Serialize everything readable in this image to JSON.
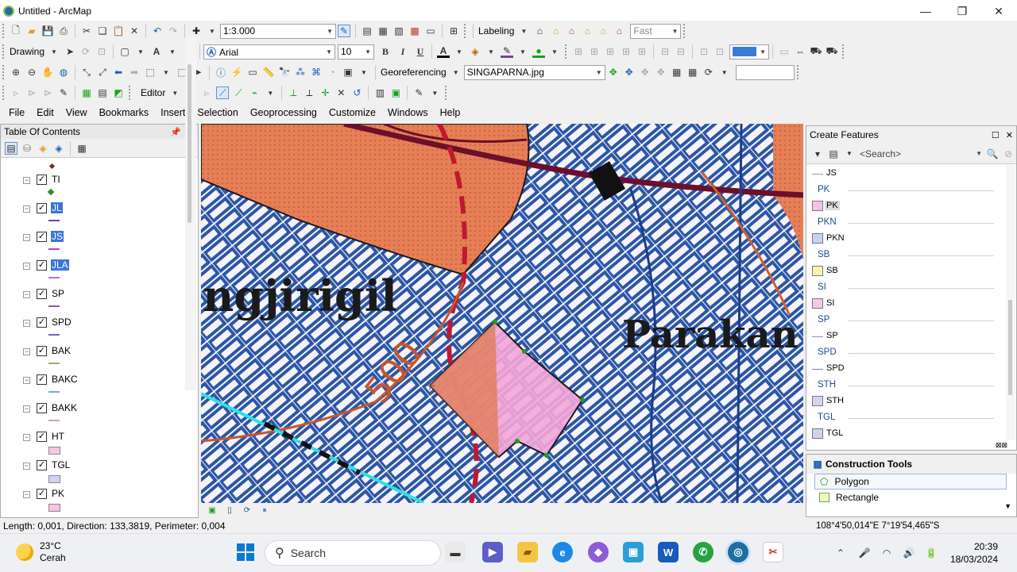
{
  "window": {
    "title": "Untitled - ArcMap"
  },
  "toolbar1": {
    "scale": "1:3.000",
    "labeling": "Labeling",
    "quality": "Fast"
  },
  "toolbar2": {
    "drawing": "Drawing",
    "font": "Arial",
    "size": "10",
    "bold": "B",
    "italic": "I",
    "underline": "U",
    "color_accent": "#3a7bd5"
  },
  "toolbar3": {
    "georeferencing": "Georeferencing",
    "layer": "SINGAPARNA.jpg"
  },
  "toolbar4": {
    "editor": "Editor"
  },
  "menu": [
    "File",
    "Edit",
    "View",
    "Bookmarks",
    "Insert",
    "Selection",
    "Geoprocessing",
    "Customize",
    "Windows",
    "Help"
  ],
  "toc": {
    "title": "Table Of Contents",
    "layers": [
      {
        "name": "TI",
        "symbol": "point",
        "color": "#2e8b3a",
        "selected": false
      },
      {
        "name": "JL",
        "symbol": "line",
        "color": "#7b3fa0",
        "selected": true
      },
      {
        "name": "JS",
        "symbol": "line",
        "color": "#b04ab0",
        "selected": true
      },
      {
        "name": "JLA",
        "symbol": "line",
        "color": "#b870c8",
        "selected": true
      },
      {
        "name": "SP",
        "symbol": "line",
        "color": "#8a5ac0",
        "selected": false
      },
      {
        "name": "SPD",
        "symbol": "line",
        "color": "#6a6ab8",
        "selected": false
      },
      {
        "name": "BAK",
        "symbol": "line",
        "color": "#9ab060",
        "selected": false
      },
      {
        "name": "BAKC",
        "symbol": "line",
        "color": "#6fb0c0",
        "selected": false
      },
      {
        "name": "BAKK",
        "symbol": "line",
        "color": "#c0a0d0",
        "selected": false
      },
      {
        "name": "HT",
        "symbol": "box",
        "color": "#f4c6e8",
        "selected": false
      },
      {
        "name": "TGL",
        "symbol": "box",
        "color": "#cfd3f3",
        "selected": false
      },
      {
        "name": "PK",
        "symbol": "box",
        "color": "#f8c2e8",
        "selected": false
      }
    ]
  },
  "map": {
    "label_place1": "ngjirigil",
    "label_place2": "Parakan",
    "label_contour": "500"
  },
  "create_features": {
    "title": "Create Features",
    "search_placeholder": "<Search>",
    "entries": [
      {
        "type": "item",
        "label": "JS",
        "symbol": "line",
        "color": "#999999"
      },
      {
        "type": "group",
        "label": "PK"
      },
      {
        "type": "item",
        "label": "PK",
        "symbol": "box",
        "color": "#f8c2e8",
        "selected": true
      },
      {
        "type": "group",
        "label": "PKN"
      },
      {
        "type": "item",
        "label": "PKN",
        "symbol": "box",
        "color": "#c6d2f2"
      },
      {
        "type": "group",
        "label": "SB"
      },
      {
        "type": "item",
        "label": "SB",
        "symbol": "box",
        "color": "#f8f4b0"
      },
      {
        "type": "group",
        "label": "SI"
      },
      {
        "type": "item",
        "label": "SI",
        "symbol": "box",
        "color": "#f7c8e6"
      },
      {
        "type": "group",
        "label": "SP"
      },
      {
        "type": "item",
        "label": "SP",
        "symbol": "line",
        "color": "#8a8ad6"
      },
      {
        "type": "group",
        "label": "SPD"
      },
      {
        "type": "item",
        "label": "SPD",
        "symbol": "line",
        "color": "#7a7ac6"
      },
      {
        "type": "group",
        "label": "STH"
      },
      {
        "type": "item",
        "label": "STH",
        "symbol": "box",
        "color": "#d8d2f2"
      },
      {
        "type": "group",
        "label": "TGL"
      },
      {
        "type": "item",
        "label": "TGL",
        "symbol": "box",
        "color": "#cfd3f3"
      }
    ]
  },
  "construction_tools": {
    "title": "Construction Tools",
    "items": [
      "Polygon",
      "Rectangle"
    ]
  },
  "status": {
    "measure": "Length: 0,001, Direction: 133,3819, Perimeter: 0,004",
    "coords": "108°4'50,014\"E  7°19'54,465\"S"
  },
  "taskbar": {
    "temp": "23°C",
    "weather": "Cerah",
    "search": "Search",
    "time": "20:39",
    "date": "18/03/2024"
  }
}
